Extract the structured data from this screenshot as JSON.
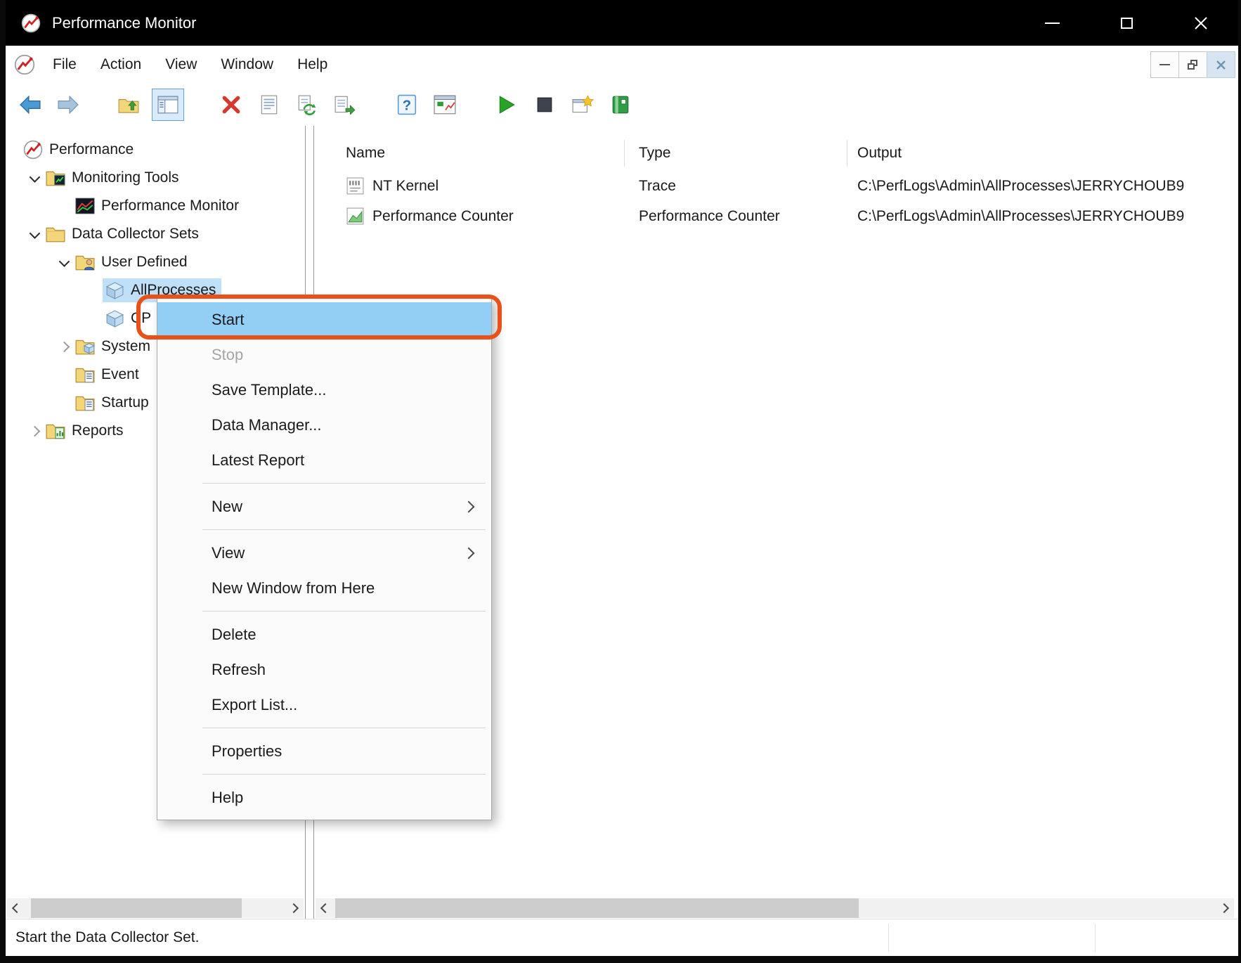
{
  "colors": {
    "titlebar_bg": "#000000",
    "menu_highlight_blue": "#93cef5",
    "tree_selection_blue": "#bfe0f7",
    "annotation_orange": "#e8511c"
  },
  "titlebar": {
    "title": "Performance Monitor",
    "controls": [
      "minimize",
      "maximize",
      "close"
    ]
  },
  "menubar": {
    "items": [
      "File",
      "Action",
      "View",
      "Window",
      "Help"
    ],
    "mdi_controls": [
      "minimize",
      "restore",
      "close"
    ]
  },
  "toolbar": {
    "icons": [
      "back",
      "forward",
      "up-one-level",
      "show-hide-console-tree",
      "delete",
      "properties",
      "refresh",
      "export-list",
      "help",
      "show-window",
      "start",
      "stop",
      "new-data-collector-set",
      "view-log-data"
    ],
    "pressed_icon": "show-hide-console-tree"
  },
  "tree": {
    "items": [
      {
        "label": "Performance",
        "level": 0,
        "icon": "performance-logo",
        "chevron": "none",
        "selected": false
      },
      {
        "label": "Monitoring Tools",
        "level": 1,
        "icon": "monitoring-tools-folder",
        "chevron": "expanded",
        "selected": false
      },
      {
        "label": "Performance Monitor",
        "level": 2,
        "icon": "performance-chart",
        "chevron": "none",
        "selected": false
      },
      {
        "label": "Data Collector Sets",
        "level": 1,
        "icon": "folder",
        "chevron": "expanded",
        "selected": false
      },
      {
        "label": "User Defined",
        "level": 2,
        "icon": "user-folder",
        "chevron": "expanded",
        "selected": false
      },
      {
        "label": "AllProcesses",
        "level": 3,
        "icon": "cube",
        "chevron": "none",
        "selected": true
      },
      {
        "label": "CP",
        "level": 3,
        "icon": "cube",
        "chevron": "none",
        "selected": false
      },
      {
        "label": "System",
        "level": 2,
        "icon": "system-folder",
        "chevron": "collapsed",
        "selected": false
      },
      {
        "label": "Event",
        "level": 2,
        "icon": "event-folder",
        "chevron": "none",
        "selected": false
      },
      {
        "label": "Startup",
        "level": 2,
        "icon": "event-folder",
        "chevron": "none",
        "selected": false
      },
      {
        "label": "Reports",
        "level": 1,
        "icon": "reports-folder",
        "chevron": "collapsed",
        "selected": false
      }
    ]
  },
  "list": {
    "columns": [
      "Name",
      "Type",
      "Output"
    ],
    "rows": [
      {
        "icon": "trace",
        "name": "NT Kernel",
        "type": "Trace",
        "output": "C:\\PerfLogs\\Admin\\AllProcesses\\JERRYCHOUB9"
      },
      {
        "icon": "performance-counter",
        "name": "Performance Counter",
        "type": "Performance Counter",
        "output": "C:\\PerfLogs\\Admin\\AllProcesses\\JERRYCHOUB9"
      }
    ]
  },
  "context_menu": {
    "items": [
      {
        "label": "Start",
        "state": "highlighted"
      },
      {
        "label": "Stop",
        "state": "disabled"
      },
      {
        "label": "Save Template...",
        "state": "normal"
      },
      {
        "label": "Data Manager...",
        "state": "normal"
      },
      {
        "label": "Latest Report",
        "state": "normal"
      },
      {
        "type": "separator"
      },
      {
        "label": "New",
        "state": "normal",
        "submenu": true
      },
      {
        "type": "separator"
      },
      {
        "label": "View",
        "state": "normal",
        "submenu": true
      },
      {
        "label": "New Window from Here",
        "state": "normal"
      },
      {
        "type": "separator"
      },
      {
        "label": "Delete",
        "state": "normal"
      },
      {
        "label": "Refresh",
        "state": "normal"
      },
      {
        "label": "Export List...",
        "state": "normal"
      },
      {
        "type": "separator"
      },
      {
        "label": "Properties",
        "state": "normal"
      },
      {
        "type": "separator"
      },
      {
        "label": "Help",
        "state": "normal"
      }
    ]
  },
  "statusbar": {
    "text": "Start the Data Collector Set."
  }
}
